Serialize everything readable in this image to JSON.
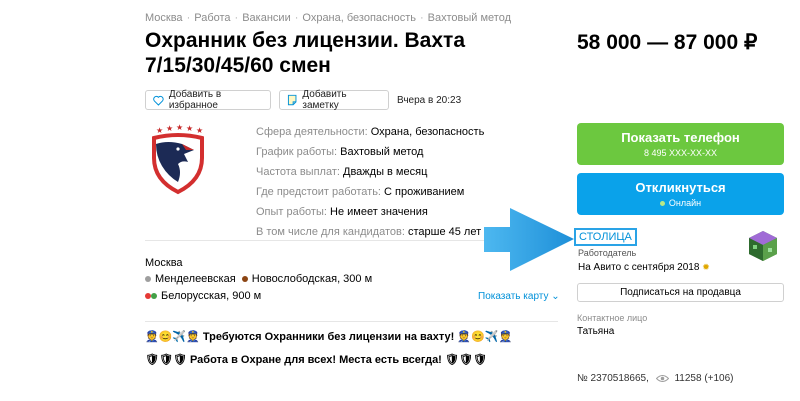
{
  "breadcrumbs": [
    "Москва",
    "Работа",
    "Вакансии",
    "Охрана, безопасность",
    "Вахтовый метод"
  ],
  "breadcrumb_separator": "·",
  "title": "Охранник без лицензии. Вахта 7/15/30/45/60 смен",
  "price": "58 000 — 87 000 ₽",
  "actions": {
    "favorite": "Добавить в избранное",
    "note": "Добавить заметку",
    "date": "Вчера в 20:23"
  },
  "params": [
    {
      "label": "Сфера деятельности:",
      "value": "Охрана, безопасность"
    },
    {
      "label": "График работы:",
      "value": "Вахтовый метод"
    },
    {
      "label": "Частота выплат:",
      "value": "Дважды в месяц"
    },
    {
      "label": "Где предстоит работать:",
      "value": "С проживанием"
    },
    {
      "label": "Опыт работы:",
      "value": "Не имеет значения"
    },
    {
      "label": "В том числе для кандидатов:",
      "value": "старше 45 лет"
    }
  ],
  "location": {
    "city": "Москва",
    "metro": [
      {
        "name": "Менделеевская",
        "color": "#9e9e9e"
      },
      {
        "name": "Новослободская, 300 м",
        "color": "#8b4513"
      },
      {
        "name": "Белорусская, 900 м",
        "color": "#e53935",
        "color2": "#43a047"
      }
    ],
    "map_link": "Показать карту"
  },
  "promo": [
    {
      "prefix": "👮😊✈️👮",
      "text": "Требуются Охранники без лицензии на вахту!",
      "suffix": "👮😊✈️👮"
    },
    {
      "prefix": "🛡🛡🛡",
      "text": "Работа в Охране для всех! Места есть всегда!",
      "suffix": "🛡🛡🛡"
    }
  ],
  "sidebar": {
    "show_phone": "Показать телефон",
    "phone_masked": "8 495 XXX-XX-XX",
    "respond": "Откликнуться",
    "online": "Онлайн",
    "seller_name": "СТОЛИЦА",
    "seller_role": "Работодатель",
    "seller_since": "На Авито с сентября 2018",
    "subscribe": "Подписаться на продавца",
    "contact_label": "Контактное лицо",
    "contact_name": "Татьяна",
    "listing_id": "№ 2370518665,",
    "views": "11258 (+106)"
  },
  "colors": {
    "phone_button": "#6cc83f",
    "respond_button": "#0aa2ea",
    "link": "#0091d9",
    "arrow": "#1e9de0"
  }
}
